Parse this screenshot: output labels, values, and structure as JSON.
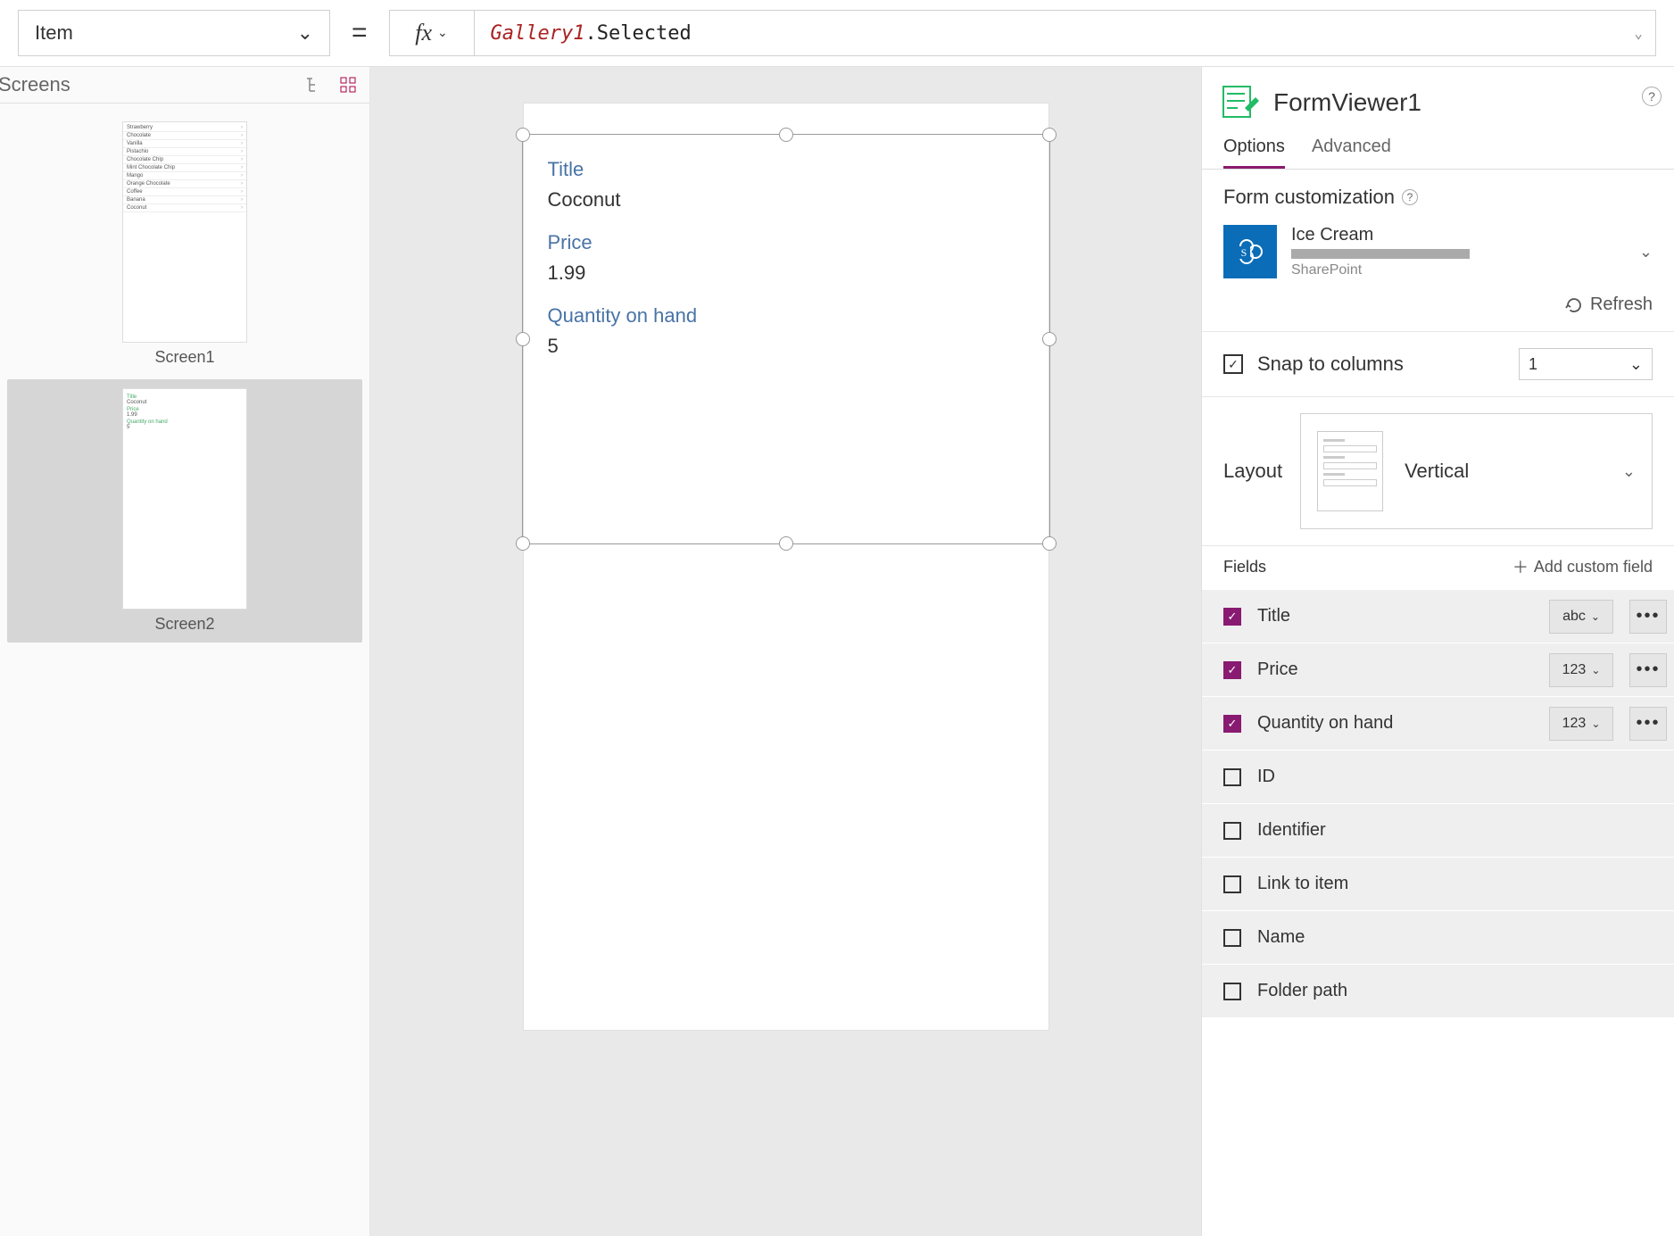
{
  "formulaBar": {
    "property": "Item",
    "fxLabel": "fx",
    "expressionIdent": "Gallery1",
    "expressionProp": ".Selected"
  },
  "screensPanel": {
    "title": "Screens",
    "screens": [
      {
        "label": "Screen1",
        "type": "list"
      },
      {
        "label": "Screen2",
        "type": "form"
      }
    ],
    "screen1Rows": [
      "Strawberry",
      "Chocolate",
      "Vanilla",
      "Pistachio",
      "Chocolate Chip",
      "Mint Chocolate Chip",
      "Mango",
      "Orange Chocolate",
      "Coffee",
      "Banana",
      "Coconut"
    ]
  },
  "canvasForm": {
    "fields": [
      {
        "label": "Title",
        "value": "Coconut"
      },
      {
        "label": "Price",
        "value": "1.99"
      },
      {
        "label": "Quantity on hand",
        "value": "5"
      }
    ]
  },
  "propsPanel": {
    "controlName": "FormViewer1",
    "tabs": {
      "options": "Options",
      "advanced": "Advanced",
      "active": "options"
    },
    "formCustomizationLabel": "Form customization",
    "dataSource": {
      "name": "Ice Cream",
      "type": "SharePoint"
    },
    "refreshLabel": "Refresh",
    "snapLabel": "Snap to columns",
    "snapChecked": true,
    "columns": "1",
    "layoutLabel": "Layout",
    "layoutValue": "Vertical",
    "fieldsLabel": "Fields",
    "addCustomLabel": "Add custom field",
    "fieldList": [
      {
        "name": "Title",
        "checked": true,
        "type": "abc"
      },
      {
        "name": "Price",
        "checked": true,
        "type": "123"
      },
      {
        "name": "Quantity on hand",
        "checked": true,
        "type": "123"
      },
      {
        "name": "ID",
        "checked": false
      },
      {
        "name": "Identifier",
        "checked": false
      },
      {
        "name": "Link to item",
        "checked": false
      },
      {
        "name": "Name",
        "checked": false
      },
      {
        "name": "Folder path",
        "checked": false
      }
    ]
  }
}
